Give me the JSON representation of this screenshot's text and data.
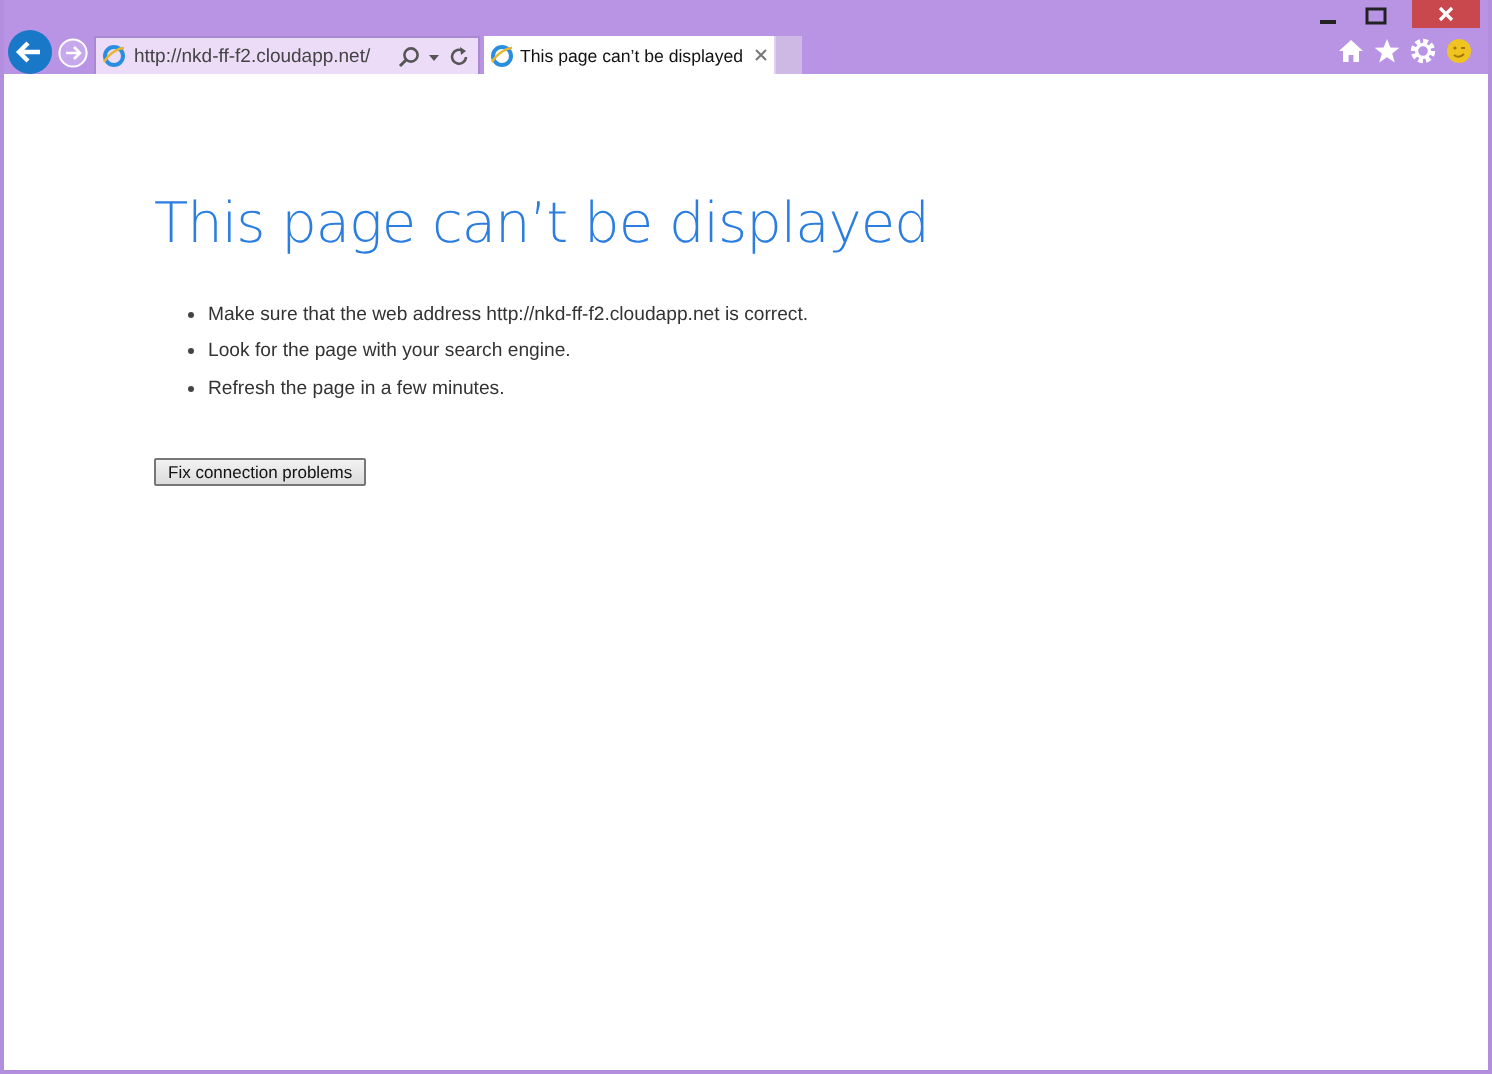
{
  "address_bar": {
    "url": "http://nkd-ff-f2.cloudapp.net/"
  },
  "tabs": [
    {
      "label": "This page can’t be displayed",
      "selected": true
    }
  ],
  "page": {
    "heading": "This page can’t be displayed",
    "tips": [
      "Make sure that the web address http://nkd-ff-f2.cloudapp.net is correct.",
      "Look for the page with your search engine.",
      "Refresh the page in a few minutes."
    ],
    "button": "Fix connection problems"
  }
}
